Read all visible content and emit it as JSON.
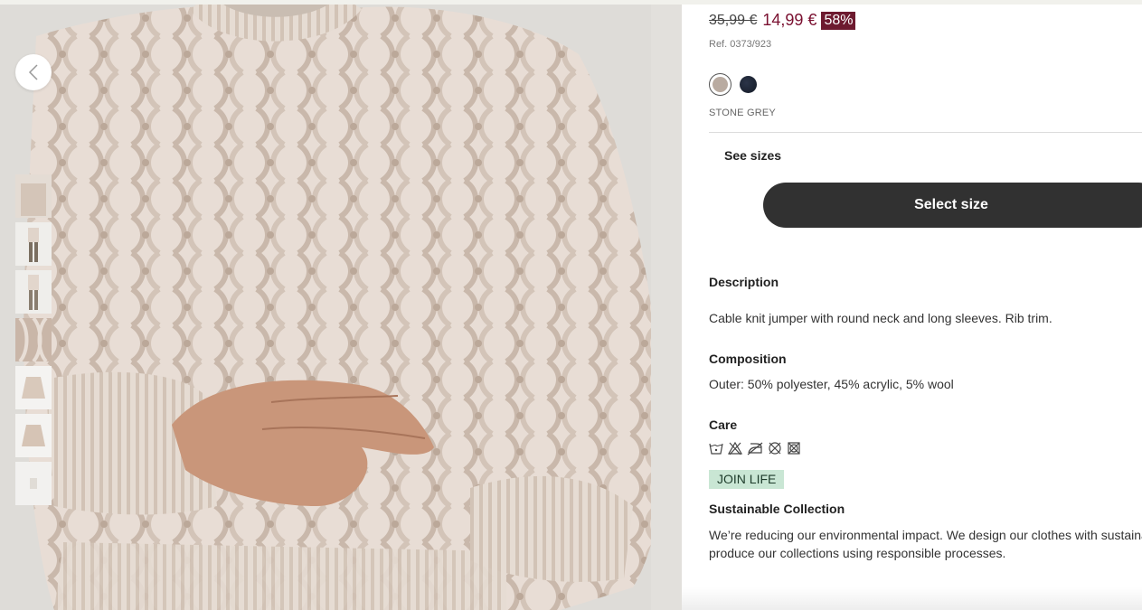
{
  "product": {
    "old_price": "35,99 €",
    "new_price": "14,99 €",
    "discount": "58%",
    "reference": "Ref. 0373/923",
    "selected_color": "STONE GREY",
    "colors": [
      {
        "name": "stone-grey",
        "hex": "#b9aba1",
        "selected": true
      },
      {
        "name": "navy",
        "hex": "#1c2232",
        "selected": false
      }
    ]
  },
  "actions": {
    "see_sizes": "See sizes",
    "select_size": "Select size"
  },
  "description": {
    "heading": "Description",
    "text": "Cable knit jumper with round neck and long sleeves. Rib trim."
  },
  "composition": {
    "heading": "Composition",
    "text": "Outer: 50% polyester, 45% acrylic, 5% wool"
  },
  "care": {
    "heading": "Care",
    "icons": [
      "wash-30-icon",
      "do-not-bleach-icon",
      "iron-low-icon",
      "do-not-dry-clean-icon",
      "do-not-tumble-dry-icon"
    ]
  },
  "sustainability": {
    "badge": "JOIN LIFE",
    "heading": "Sustainable Collection",
    "line1": "We’re reducing our environmental impact. We design our clothes with sustaina",
    "line2": "produce our collections using responsible processes."
  },
  "gallery": {
    "thumbnail_count": 7,
    "nav_prev_icon": "chevron-left-icon"
  },
  "colors": {
    "price_red": "#7a1030",
    "discount_bg": "#6d1a2f",
    "button_bg": "#313131",
    "badge_bg": "#c9e6d4"
  }
}
